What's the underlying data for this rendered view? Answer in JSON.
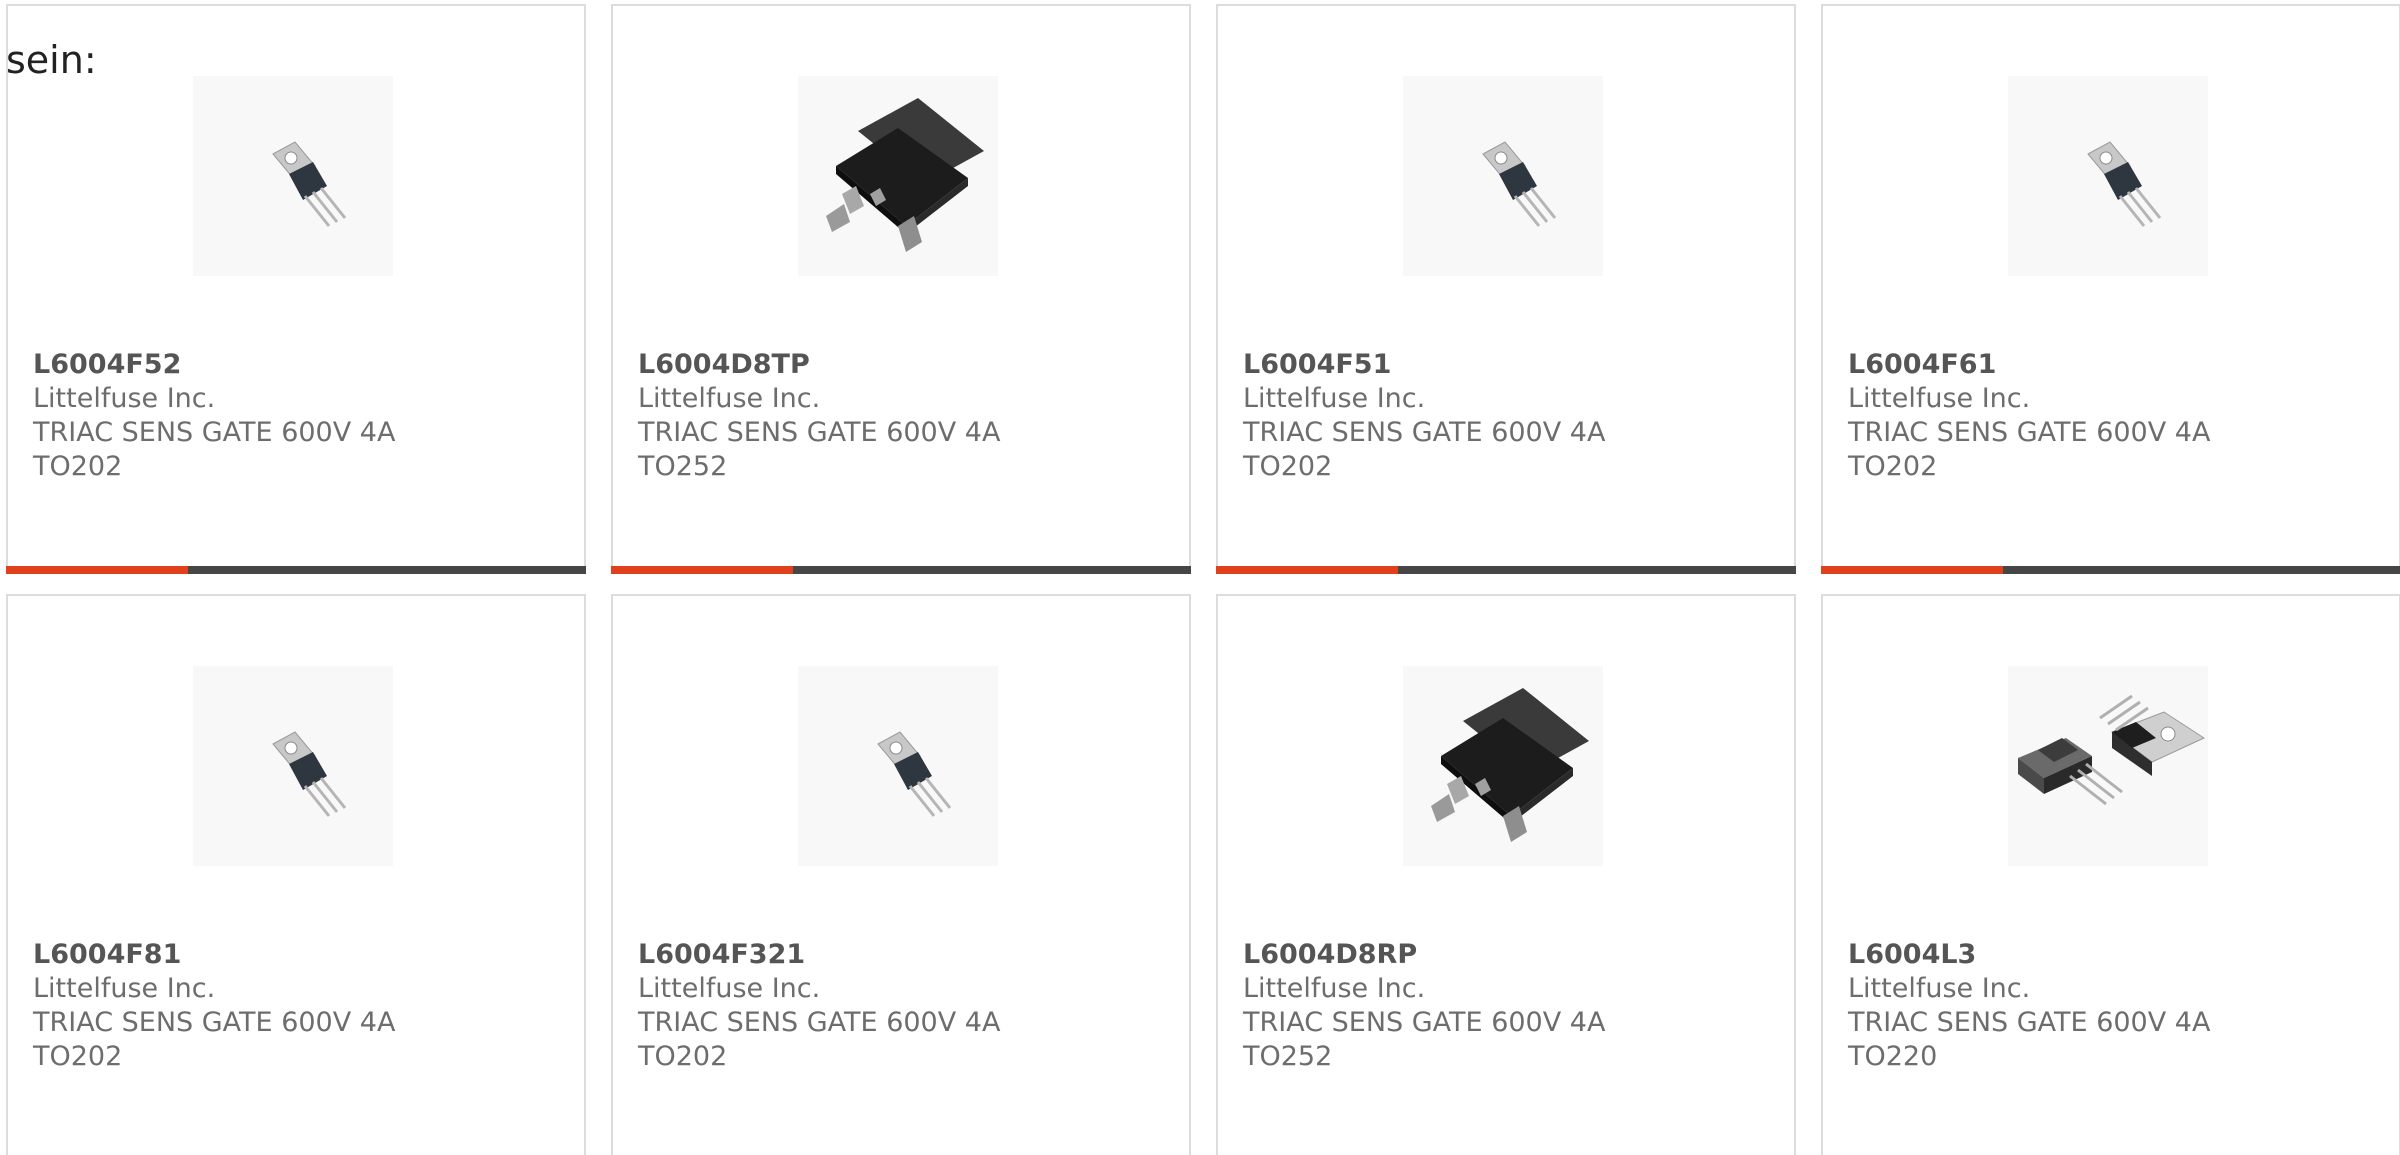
{
  "intro": {
    "text": "sein:"
  },
  "colors": {
    "accent_bar": "#e0401c",
    "base_bar": "#464646",
    "card_border": "#dcdcdc",
    "text": "#6d6d6d"
  },
  "products": [
    {
      "part_number": "L6004F52",
      "manufacturer": "Littelfuse Inc.",
      "description": "TRIAC SENS GATE 600V 4A",
      "package": "TO202",
      "image": "to202-package-icon"
    },
    {
      "part_number": "L6004D8TP",
      "manufacturer": "Littelfuse Inc.",
      "description": "TRIAC SENS GATE 600V 4A",
      "package": "TO252",
      "image": "to252-package-icon"
    },
    {
      "part_number": "L6004F51",
      "manufacturer": "Littelfuse Inc.",
      "description": "TRIAC SENS GATE 600V 4A",
      "package": "TO202",
      "image": "to202-package-icon"
    },
    {
      "part_number": "L6004F61",
      "manufacturer": "Littelfuse Inc.",
      "description": "TRIAC SENS GATE 600V 4A",
      "package": "TO202",
      "image": "to202-package-icon"
    },
    {
      "part_number": "L6004F81",
      "manufacturer": "Littelfuse Inc.",
      "description": "TRIAC SENS GATE 600V 4A",
      "package": "TO202",
      "image": "to202-package-icon"
    },
    {
      "part_number": "L6004F321",
      "manufacturer": "Littelfuse Inc.",
      "description": "TRIAC SENS GATE 600V 4A",
      "package": "TO202",
      "image": "to202-package-icon"
    },
    {
      "part_number": "L6004D8RP",
      "manufacturer": "Littelfuse Inc.",
      "description": "TRIAC SENS GATE 600V 4A",
      "package": "TO252",
      "image": "to252-package-icon"
    },
    {
      "part_number": "L6004L3",
      "manufacturer": "Littelfuse Inc.",
      "description": "TRIAC SENS GATE 600V 4A",
      "package": "TO220",
      "image": "to220-package-icon"
    }
  ]
}
